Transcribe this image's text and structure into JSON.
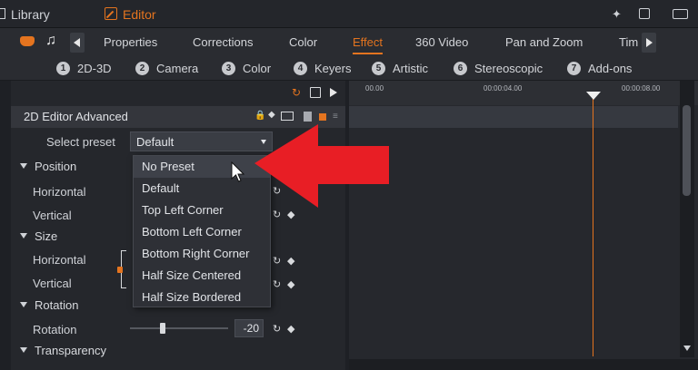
{
  "topbar": {
    "library_label": "Library",
    "editor_label": "Editor",
    "right_icons": [
      "wand-icon",
      "copy-window-icon",
      "layout-icon"
    ]
  },
  "tabs": {
    "items": [
      "Properties",
      "Corrections",
      "Color",
      "Effect",
      "360 Video",
      "Pan and Zoom",
      "Tim"
    ],
    "active": "Effect"
  },
  "categories": [
    {
      "num": "1",
      "label": "2D-3D"
    },
    {
      "num": "2",
      "label": "Camera"
    },
    {
      "num": "3",
      "label": "Color"
    },
    {
      "num": "4",
      "label": "Keyers"
    },
    {
      "num": "5",
      "label": "Artistic"
    },
    {
      "num": "6",
      "label": "Stereoscopic"
    },
    {
      "num": "7",
      "label": "Add-ons"
    }
  ],
  "panel": {
    "title": "2D Editor Advanced",
    "select_preset_label": "Select preset",
    "preset_value": "Default",
    "sections": {
      "position": "Position",
      "size": "Size",
      "rotation": "Rotation",
      "transparency": "Transparency"
    },
    "props": {
      "pos_h": "Horizontal",
      "pos_v": "Vertical",
      "size_h": "Horizontal",
      "size_v": "Vertical",
      "rotation": "Rotation"
    },
    "rotation_value": "-20",
    "rotation_level": 0.33
  },
  "dropdown": {
    "options": [
      "No Preset",
      "Default",
      "Top Left Corner",
      "Bottom Left Corner",
      "Bottom Right Corner",
      "Half Size Centered",
      "Half Size Bordered"
    ],
    "highlighted": "No Preset"
  },
  "timeline": {
    "timecodes": [
      "00.00",
      "00:00:04.00",
      "00:00:08.00"
    ]
  },
  "colors": {
    "accent": "#e4741f",
    "arrow": "#e81e25"
  }
}
